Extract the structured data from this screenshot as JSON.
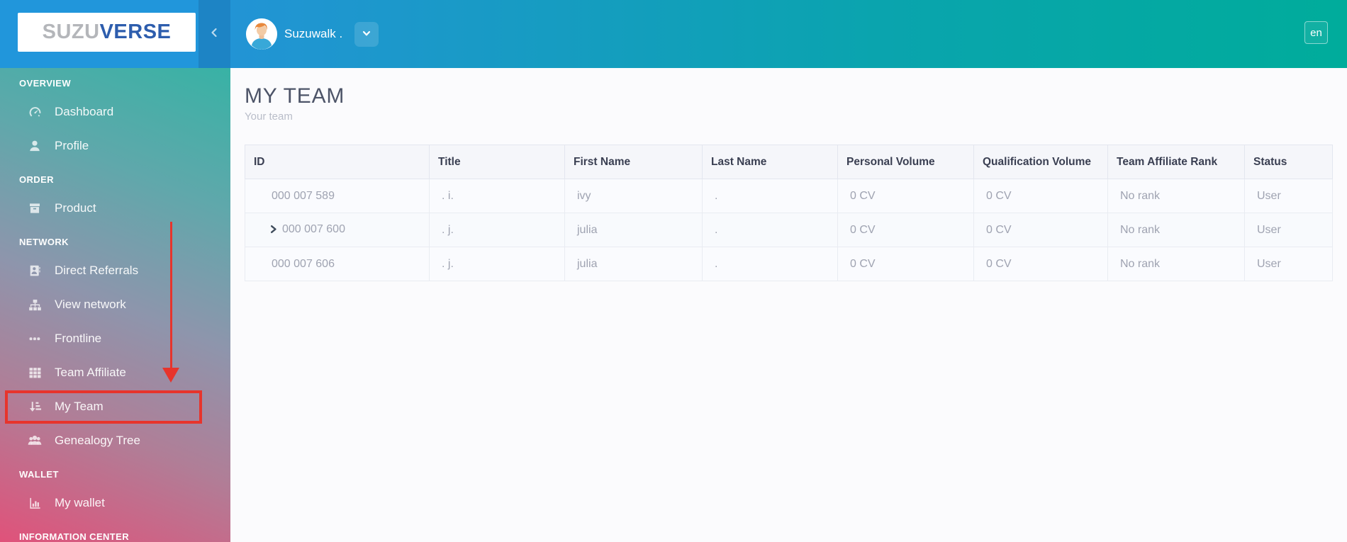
{
  "brand": {
    "name_part1": "SUZU",
    "name_part2": "VERSE"
  },
  "topbar": {
    "user_name": "Suzuwalk .",
    "language_badge": "en"
  },
  "sidebar": {
    "sections": [
      {
        "label": "OVERVIEW",
        "items": [
          {
            "label": "Dashboard",
            "icon": "dashboard-icon"
          },
          {
            "label": "Profile",
            "icon": "user-icon"
          }
        ]
      },
      {
        "label": "ORDER",
        "items": [
          {
            "label": "Product",
            "icon": "product-icon"
          }
        ]
      },
      {
        "label": "NETWORK",
        "items": [
          {
            "label": "Direct Referrals",
            "icon": "address-book-icon"
          },
          {
            "label": "View network",
            "icon": "sitemap-icon"
          },
          {
            "label": "Frontline",
            "icon": "ellipsis-icon"
          },
          {
            "label": "Team Affiliate",
            "icon": "table-icon"
          },
          {
            "label": "My Team",
            "icon": "sort-amount-icon",
            "highlighted": true
          },
          {
            "label": "Genealogy Tree",
            "icon": "users-icon"
          }
        ]
      },
      {
        "label": "WALLET",
        "items": [
          {
            "label": "My wallet",
            "icon": "bar-chart-icon"
          }
        ]
      },
      {
        "label": "INFORMATION CENTER",
        "items": []
      }
    ]
  },
  "page": {
    "title": "MY TEAM",
    "subtitle": "Your team"
  },
  "team_table": {
    "columns": [
      "ID",
      "Title",
      "First Name",
      "Last Name",
      "Personal Volume",
      "Qualification Volume",
      "Team Affiliate Rank",
      "Status"
    ],
    "rows": [
      {
        "id": "000 007 589",
        "expandable": false,
        "title": ". i.",
        "first_name": "ivy",
        "last_name": ".",
        "personal_volume": "0 CV",
        "qualification_volume": "0 CV",
        "team_affiliate_rank": "No rank",
        "status": "User"
      },
      {
        "id": "000 007 600",
        "expandable": true,
        "title": ". j.",
        "first_name": "julia",
        "last_name": ".",
        "personal_volume": "0 CV",
        "qualification_volume": "0 CV",
        "team_affiliate_rank": "No rank",
        "status": "User"
      },
      {
        "id": "000 007 606",
        "expandable": false,
        "title": ". j.",
        "first_name": "julia",
        "last_name": ".",
        "personal_volume": "0 CV",
        "qualification_volume": "0 CV",
        "team_affiliate_rank": "No rank",
        "status": "User"
      }
    ]
  },
  "annotation": {
    "highlight_color": "#e7342c",
    "target_item": "My Team"
  },
  "colors": {
    "brand_blue": "#2196db",
    "header_blue": "#2294d5",
    "header_teal": "#00ac9b",
    "sidebar_teal": "#38b2a5",
    "sidebar_pink": "#e0527a",
    "logo_gray": "#b4b6ba",
    "logo_blue": "#2d5dad"
  }
}
